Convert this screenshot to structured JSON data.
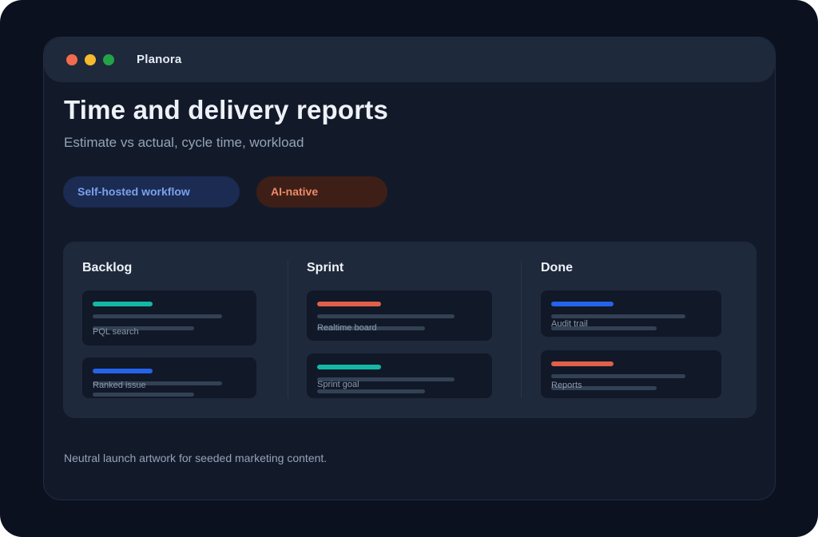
{
  "window": {
    "app_title": "Planora",
    "controls": [
      {
        "name": "close",
        "color": "#f26b4f"
      },
      {
        "name": "minimize",
        "color": "#f7b92e"
      },
      {
        "name": "maximize",
        "color": "#22a347"
      }
    ]
  },
  "header": {
    "title": "Time and delivery reports",
    "subtitle": "Estimate vs actual, cycle time, workload"
  },
  "tags": [
    {
      "label": "Self-hosted workflow",
      "color": "#7aa2ee"
    },
    {
      "label": "AI-native",
      "color": "#f08a68"
    }
  ],
  "board": {
    "columns": [
      {
        "title": "Backlog",
        "cards": [
          {
            "label": "PQL search",
            "accent": "#14b8a6"
          },
          {
            "label": "Ranked issue",
            "accent": "#2563eb"
          }
        ]
      },
      {
        "title": "Sprint",
        "cards": [
          {
            "label": "Realtime board",
            "accent": "#e0604a"
          },
          {
            "label": "Sprint goal",
            "accent": "#14b8a6"
          }
        ]
      },
      {
        "title": "Done",
        "cards": [
          {
            "label": "Audit trail",
            "accent": "#2563eb"
          },
          {
            "label": "Reports",
            "accent": "#e0604a"
          }
        ]
      }
    ]
  },
  "footer": {
    "note": "Neutral launch artwork for seeded marketing content."
  },
  "colors": {
    "background": "#0c1120",
    "window": "#121a2a",
    "titlebar": "#1e293b",
    "board": "#1e293b",
    "card": "#111827"
  }
}
